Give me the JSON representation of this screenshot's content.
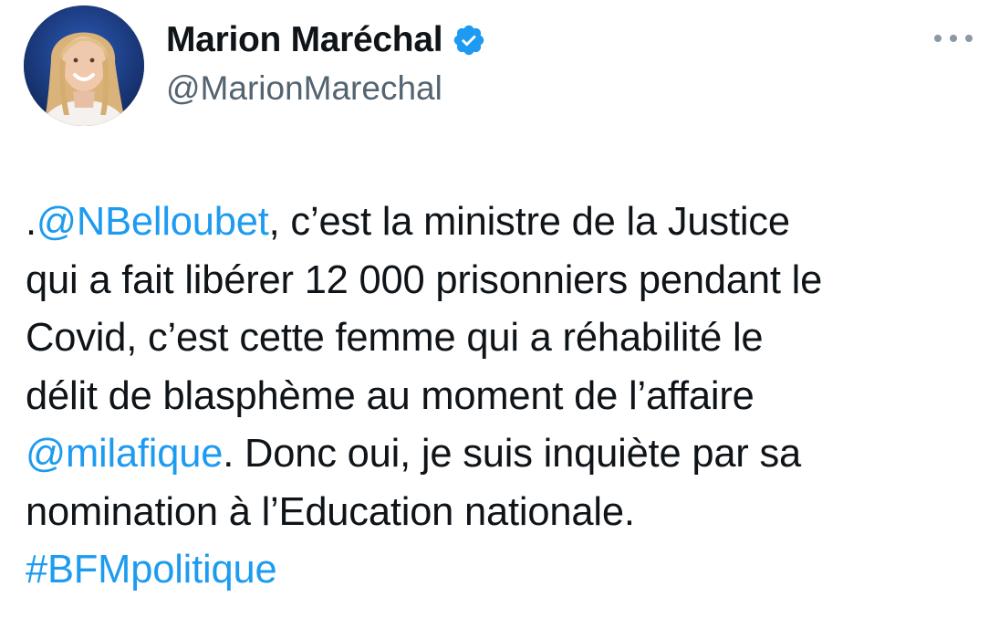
{
  "author": {
    "display_name": "Marion Maréchal",
    "handle": "@MarionMarechal",
    "verified": true,
    "avatar_icon": "profile-photo-woman-blonde"
  },
  "menu": {
    "more_icon": "ellipsis-icon"
  },
  "tweet": {
    "line1": {
      "prefix": ".",
      "mention": "@NBelloubet",
      "text": ", c’est la ministre de la Justice"
    },
    "line2": "qui a fait libérer 12 000 prisonniers pendant le",
    "line3": "Covid, c’est cette femme qui a réhabilité le",
    "line4": "délit de blasphème au moment de l’affaire",
    "line5": {
      "mention": "@milafique",
      "text": ". Donc oui, je suis inquiète par sa"
    },
    "line6": "nomination à l’Education nationale.",
    "line7": {
      "hashtag": "#BFMpolitique"
    }
  },
  "colors": {
    "link": "#1d9bf0",
    "handle": "#536471",
    "text": "#0f1419",
    "verified_badge": "#1d9bf0"
  }
}
